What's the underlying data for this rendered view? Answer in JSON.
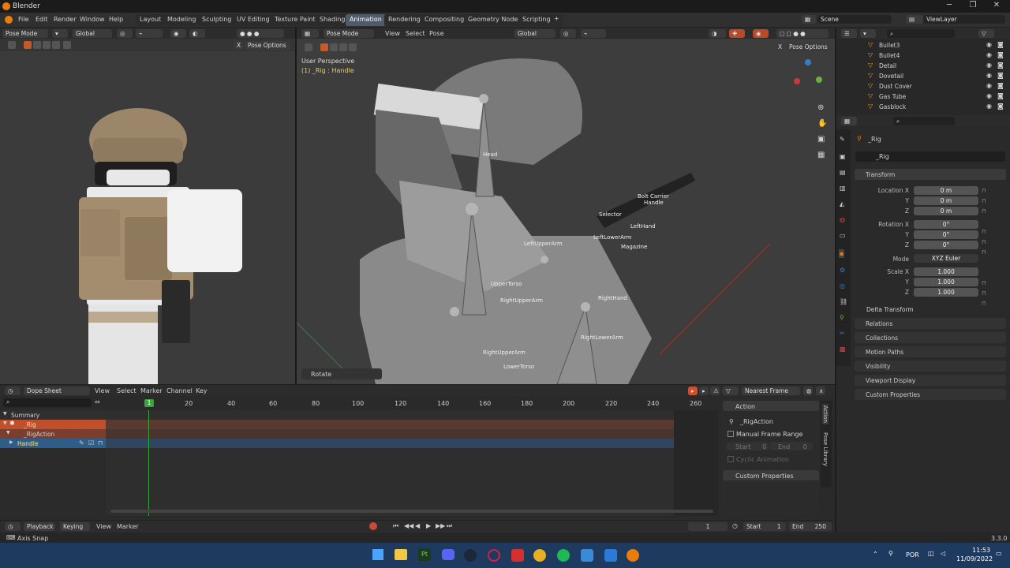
{
  "window": {
    "title": "Blender"
  },
  "menu": [
    "File",
    "Edit",
    "Render",
    "Window",
    "Help"
  ],
  "workspaces": [
    "Layout",
    "Modeling",
    "Sculpting",
    "UV Editing",
    "Texture Paint",
    "Shading",
    "Animation",
    "Rendering",
    "Compositing",
    "Geometry Nodes",
    "Scripting"
  ],
  "active_workspace": "Animation",
  "scene": {
    "scene_label": "Scene",
    "view_layer": "ViewLayer"
  },
  "left_viewport": {
    "mode": "Pose Mode",
    "orientation": "Global",
    "pose_options": "Pose Options"
  },
  "main_viewport": {
    "mode": "Pose Mode",
    "menu": [
      "View",
      "Select",
      "Pose"
    ],
    "orientation": "Global",
    "pose_options": "Pose Options",
    "view_name": "User Perspective",
    "active_object": "(1) _Rig : Handle",
    "operator_panel": "Rotate",
    "bones": [
      "Head",
      "Bolt Carrier",
      "Handle",
      "Selector",
      "LeftHand",
      "LeftLowerArm",
      "LeftUpperArm",
      "Magazine",
      "UpperTorso",
      "RightUpperArm",
      "RightHand",
      "RightLowerArm",
      "RightUpperArm",
      "LowerTorso"
    ]
  },
  "outliner": {
    "items": [
      "Bullet3",
      "Bullet4",
      "Detail",
      "Dovetail",
      "Dust Cover",
      "Gas Tube",
      "Gasblock"
    ]
  },
  "properties": {
    "object_name": "_Rig",
    "data_name": "_Rig",
    "transform_label": "Transform",
    "location": {
      "label": "Location X",
      "x": "0 m",
      "y": "0 m",
      "z": "0 m"
    },
    "rotation": {
      "label": "Rotation X",
      "x": "0°",
      "y": "0°",
      "z": "0°"
    },
    "mode_label": "Mode",
    "mode_value": "XYZ Euler",
    "scale": {
      "label": "Scale X",
      "x": "1.000",
      "y": "1.000",
      "z": "1.000"
    },
    "axis_y": "Y",
    "axis_z": "Z",
    "delta_transform": "Delta Transform",
    "panels": [
      "Relations",
      "Collections",
      "Motion Paths",
      "Visibility",
      "Viewport Display",
      "Custom Properties"
    ]
  },
  "dope_sheet": {
    "editor": "Dope Sheet",
    "menu": [
      "View",
      "Select",
      "Marker",
      "Channel",
      "Key"
    ],
    "snap": "Nearest Frame",
    "frame_ticks": [
      "20",
      "40",
      "60",
      "80",
      "100",
      "120",
      "140",
      "160",
      "180",
      "200",
      "220",
      "240",
      "260"
    ],
    "current_frame_marker": "1",
    "channels": [
      "Summary",
      "_Rig",
      "_RigAction",
      "Handle"
    ],
    "action_panel": {
      "header": "Action",
      "action_name": "_RigAction",
      "manual_frame_range": "Manual Frame Range",
      "start_label": "Start",
      "start_value": "0",
      "end_label": "End",
      "end_value": "0",
      "cyclic": "Cyclic Animation",
      "custom_properties": "Custom Properties",
      "side_tabs": [
        "Action",
        "Pose Library"
      ]
    }
  },
  "timeline": {
    "playback": "Playback",
    "keying": "Keying",
    "menu": [
      "View",
      "Marker"
    ],
    "current_frame": "1",
    "start_label": "Start",
    "start": "1",
    "end_label": "End",
    "end": "250"
  },
  "status": {
    "left": "Axis Snap",
    "version": "3.3.0"
  },
  "taskbar": {
    "lang": "POR",
    "time": "11:53",
    "date": "11/09/2022"
  },
  "colors": {
    "accent": "#e87d0d",
    "active_tab": "#4f5b6b",
    "rig_row": "#c0502c",
    "action_row": "#8a4030",
    "handle_row": "#2f5d8a",
    "playhead": "#3aa33a"
  }
}
